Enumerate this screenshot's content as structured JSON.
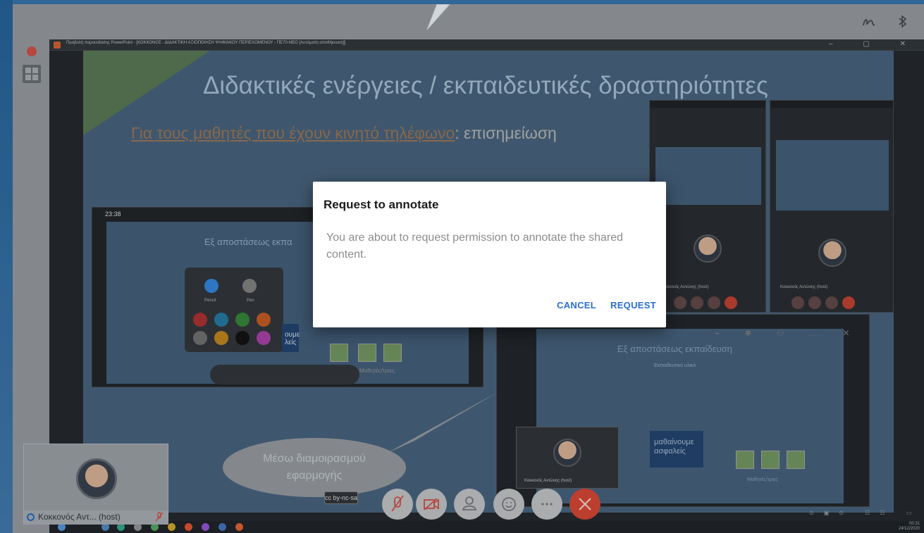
{
  "dialog": {
    "title": "Request to annotate",
    "body": "You are about to request permission to annotate the shared content.",
    "cancel_label": "CANCEL",
    "request_label": "REQUEST"
  },
  "shared_window": {
    "title": "Προβολή παρουσίασης PowerPoint - [ΚΟΚΚΟΝΟΣ - ΔΙΔΑΚΤΙΚΗ ΑΞΙΟΠΟΙΗΣΗ ΨΗΦΙΑΚΟΥ ΠΕΡΙΕΧΟΜΕΝΟΥ - ΠΕ70-ΝΕΟ [Αυτόματη αποθήκευση]]"
  },
  "slide": {
    "title": "Διδακτικές ενέργειες / εκπαιδευτικές δραστηριότητες",
    "subtitle_underlined": "Για τους μαθητές που έχουν κινητό τηλέφωνο",
    "subtitle_rest": ": επισημείωση",
    "bubble_line1": "Μέσω διαμοιρασμού",
    "bubble_line2": "εφαρμογής",
    "tablet_time": "23:38",
    "tablet_slide_title": "Εξ αποστάσεως εκπα",
    "palette_pencil": "Pencil",
    "palette_pen": "Pen",
    "tablet_board": "ουμε\nλείς",
    "tablet_caption": "Μαθητές/τριες",
    "inset_title": "Εξ αποστάσεως εκπαίδευση",
    "inset_sub": "Εκπαιδευτικό υλικό",
    "inset_board_line1": "μαθαίνουμε",
    "inset_board_line2": "ασφαλείς",
    "inset_students": "Μαθητές/τριες",
    "inset_video_label": "Κοκκονός Αντώνης (host)",
    "phone_caption": "Κοκκονός Αντώνης (host)"
  },
  "self_tile": {
    "name": "Κοκκονός Αντ... (host)"
  },
  "taskbar": {
    "time": "00:31",
    "date": "24/12/2020"
  },
  "colors": {
    "accent": "#2a6fd1",
    "leave": "#c73e2e"
  },
  "icons": {
    "annotate": "annotate-icon",
    "bluetooth": "bluetooth-icon",
    "mic_muted": "mic-off-icon",
    "video_off": "video-off-icon",
    "participants": "participants-icon",
    "reactions": "emoji-icon",
    "more": "more-icon",
    "leave": "close-icon"
  }
}
